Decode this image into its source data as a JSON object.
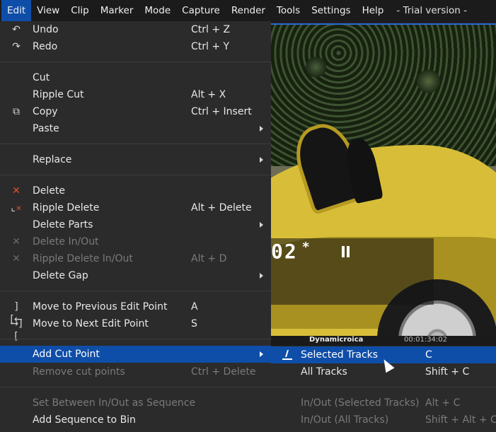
{
  "menubar": {
    "items": [
      "Edit",
      "View",
      "Clip",
      "Marker",
      "Mode",
      "Capture",
      "Render",
      "Tools",
      "Settings",
      "Help"
    ],
    "trial": "- Trial version -"
  },
  "preview": {
    "timecode": "02",
    "strip_left": "Dynamicroica",
    "strip_time": "00:01:34:02"
  },
  "edit_menu": {
    "undo": {
      "label": "Undo",
      "shortcut": "Ctrl + Z",
      "icon": "undo-icon"
    },
    "redo": {
      "label": "Redo",
      "shortcut": "Ctrl + Y",
      "icon": "redo-icon"
    },
    "cut": {
      "label": "Cut"
    },
    "ripple_cut": {
      "label": "Ripple Cut",
      "shortcut": "Alt + X"
    },
    "copy": {
      "label": "Copy",
      "shortcut": "Ctrl + Insert",
      "icon": "copy-icon"
    },
    "paste": {
      "label": "Paste"
    },
    "replace": {
      "label": "Replace"
    },
    "delete": {
      "label": "Delete",
      "icon": "delete-x-icon"
    },
    "ripple_delete": {
      "label": "Ripple Delete",
      "shortcut": "Alt + Delete",
      "icon": "ripple-delete-icon"
    },
    "delete_parts": {
      "label": "Delete Parts"
    },
    "delete_inout": {
      "label": "Delete In/Out"
    },
    "ripple_delete_inout": {
      "label": "Ripple Delete In/Out",
      "shortcut": "Alt + D"
    },
    "delete_gap": {
      "label": "Delete Gap"
    },
    "move_prev": {
      "label": "Move to Previous Edit Point",
      "shortcut": "A",
      "icon": "prev-edit-point-icon"
    },
    "move_next": {
      "label": "Move to Next Edit Point",
      "shortcut": "S",
      "icon": "next-edit-point-icon"
    },
    "add_cut": {
      "label": "Add Cut Point"
    },
    "remove_cuts": {
      "label": "Remove cut points",
      "shortcut": "Ctrl + Delete"
    },
    "set_between": {
      "label": "Set Between In/Out as Sequence"
    },
    "add_seq": {
      "label": "Add Sequence to Bin"
    }
  },
  "sub_menu": {
    "selected_tracks": {
      "label": "Selected Tracks",
      "shortcut": "C",
      "icon": "cut-tracks-icon"
    },
    "all_tracks": {
      "label": "All Tracks",
      "shortcut": "Shift + C"
    },
    "inout_selected": {
      "label": "In/Out (Selected Tracks)",
      "shortcut": "Alt + C"
    },
    "inout_all": {
      "label": "In/Out (All Tracks)",
      "shortcut": "Shift + Alt + C"
    }
  },
  "colors": {
    "highlight": "#0f4ea8",
    "menu_bg": "#2b2b2b",
    "delete_red": "#e0502a"
  }
}
